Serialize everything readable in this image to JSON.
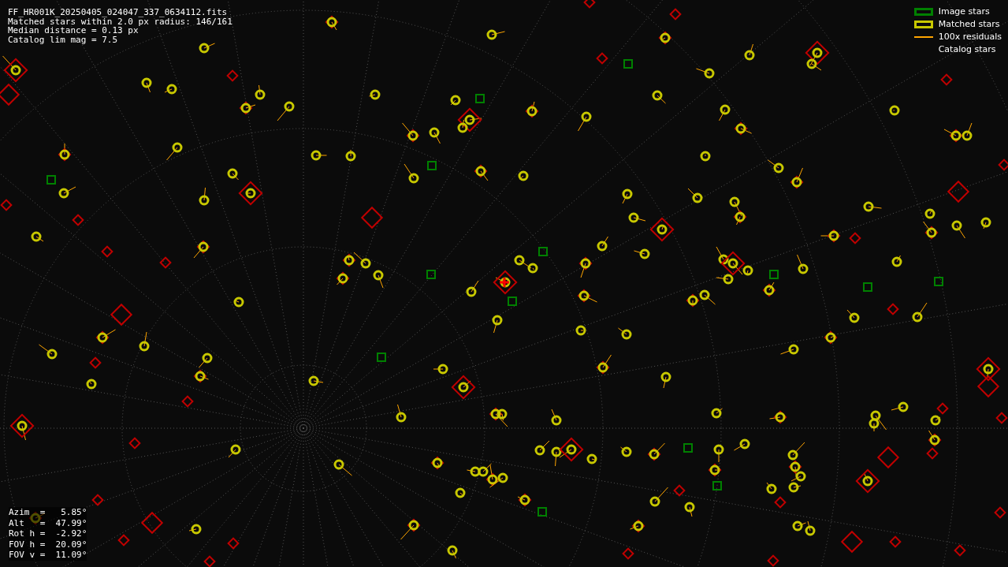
{
  "info_lines": [
    "FF_HR001K_20250405_024047_337_0634112.fits",
    "Matched stars within 2.0 px radius: 146/161",
    "Median distance = 0.13 px",
    "Catalog lim mag = 7.5"
  ],
  "legend": [
    {
      "kind": "box",
      "label": "Image stars",
      "color": "#008000"
    },
    {
      "kind": "box",
      "label": "Matched stars",
      "color": "#c8c800"
    },
    {
      "kind": "line",
      "label": "100x residuals",
      "color": "#ffa500"
    },
    {
      "kind": "none",
      "label": "Catalog stars"
    }
  ],
  "pointing_lines": [
    "Azim  =   5.85°",
    "Alt   =  47.99°",
    "Rot h =  -2.92°",
    "FOV h =  20.09°",
    "FOV v =  11.09°"
  ]
}
